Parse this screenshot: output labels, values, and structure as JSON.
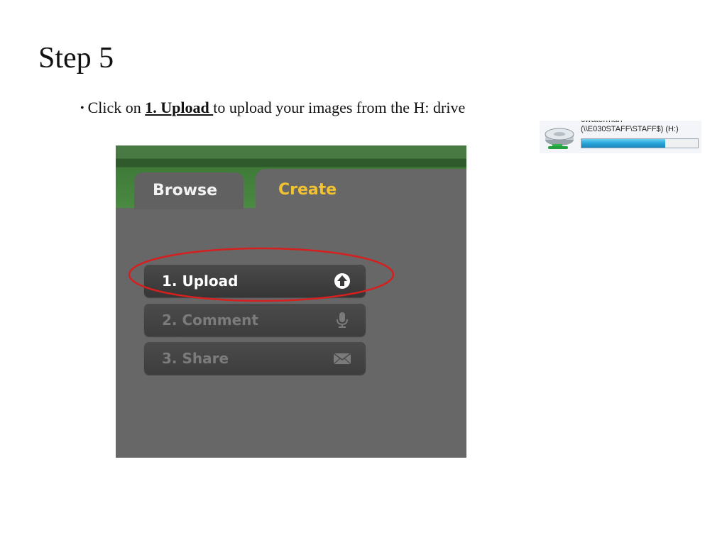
{
  "slide": {
    "title": "Step 5",
    "bullet": {
      "prefix": "Click on ",
      "link_text": "1. Upload ",
      "suffix": "to upload your images from the H: drive"
    }
  },
  "drive": {
    "name_partial": "cwaterman",
    "path_label": "(\\\\E030STAFF\\STAFF$) (H:)",
    "usage_fraction": 0.72,
    "bar_color": "#2aa8da"
  },
  "app": {
    "tabs": [
      {
        "label": "Browse",
        "active": false
      },
      {
        "label": "Create",
        "active": true,
        "color": "#f1c232"
      }
    ],
    "steps": [
      {
        "label": "1. Upload",
        "icon": "upload-arrow-icon",
        "enabled": true
      },
      {
        "label": "2. Comment",
        "icon": "microphone-icon",
        "enabled": false
      },
      {
        "label": "3. Share",
        "icon": "envelope-icon",
        "enabled": false
      }
    ]
  },
  "annotation": {
    "color": "#d61f1f"
  }
}
